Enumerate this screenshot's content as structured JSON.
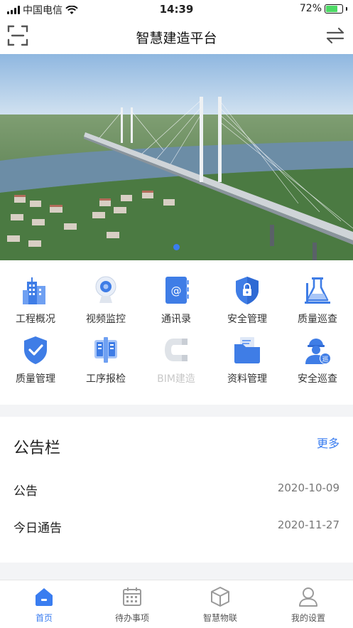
{
  "status_bar": {
    "carrier": "中国电信",
    "time": "14:39",
    "battery": "72%",
    "battery_level": 0.72
  },
  "header": {
    "title": "智慧建造平台",
    "scan_icon": "scan-icon",
    "switch_icon": "switch-arrows-icon"
  },
  "banner": {
    "description_icon": "bridge-photo",
    "page_count": 1,
    "active_page": 1
  },
  "menu": {
    "items": [
      {
        "label": "工程概况",
        "icon": "building-icon"
      },
      {
        "label": "视频监控",
        "icon": "camera-icon"
      },
      {
        "label": "通讯录",
        "icon": "contacts-book-icon"
      },
      {
        "label": "安全管理",
        "icon": "lock-shield-icon"
      },
      {
        "label": "质量巡查",
        "icon": "flask-icon"
      },
      {
        "label": "质量管理",
        "icon": "check-shield-icon"
      },
      {
        "label": "工序报检",
        "icon": "process-report-icon"
      },
      {
        "label": "BIM建造",
        "icon": "bim-icon",
        "disabled": true
      },
      {
        "label": "资料管理",
        "icon": "folder-icon"
      },
      {
        "label": "安全巡查",
        "icon": "worker-icon"
      }
    ]
  },
  "notice": {
    "title": "公告栏",
    "more": "更多",
    "rows": [
      {
        "name": "公告",
        "date": "2020-10-09"
      },
      {
        "name": "今日通告",
        "date": "2020-11-27"
      }
    ]
  },
  "tabs": [
    {
      "label": "首页",
      "icon": "home-icon",
      "active": true
    },
    {
      "label": "待办事项",
      "icon": "calendar-icon"
    },
    {
      "label": "智慧物联",
      "icon": "cube-icon"
    },
    {
      "label": "我的设置",
      "icon": "user-icon"
    }
  ],
  "colors": {
    "accent": "#3a7df0",
    "icon_blue": "#3f7de6",
    "disabled": "#c8c8c8"
  }
}
